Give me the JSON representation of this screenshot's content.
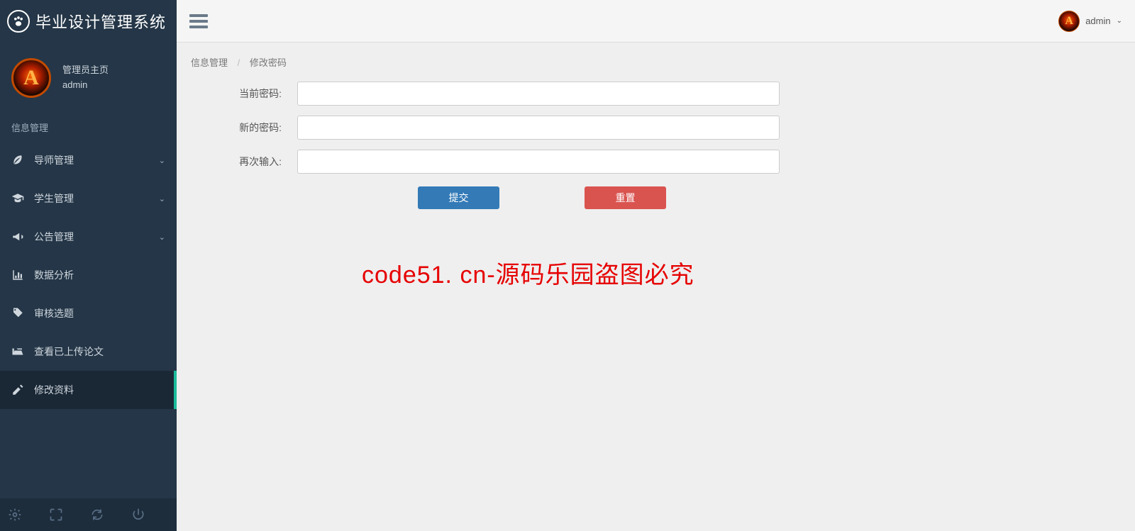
{
  "app": {
    "title": "毕业设计管理系统"
  },
  "topbar": {
    "username": "admin"
  },
  "profile": {
    "role": "管理员主页",
    "name": "admin",
    "avatar_letter": "A"
  },
  "sidebar": {
    "section_title": "信息管理",
    "items": [
      {
        "label": "导师管理",
        "has_children": true
      },
      {
        "label": "学生管理",
        "has_children": true
      },
      {
        "label": "公告管理",
        "has_children": true
      },
      {
        "label": "数据分析",
        "has_children": false
      },
      {
        "label": "审核选题",
        "has_children": false
      },
      {
        "label": "查看已上传论文",
        "has_children": false
      },
      {
        "label": "修改资料",
        "has_children": false,
        "active": true
      }
    ]
  },
  "breadcrumb": {
    "item1": "信息管理",
    "item2": "修改密码"
  },
  "form": {
    "current_password": {
      "label": "当前密码:",
      "value": ""
    },
    "new_password": {
      "label": "新的密码:",
      "value": ""
    },
    "confirm_password": {
      "label": "再次输入:",
      "value": ""
    },
    "submit_label": "提交",
    "reset_label": "重置"
  },
  "watermark": "code51. cn-源码乐园盗图必究",
  "colors": {
    "sidebar_bg": "#243647",
    "accent": "#1abc9c",
    "primary_btn": "#337ab7",
    "danger_btn": "#d9534f"
  }
}
